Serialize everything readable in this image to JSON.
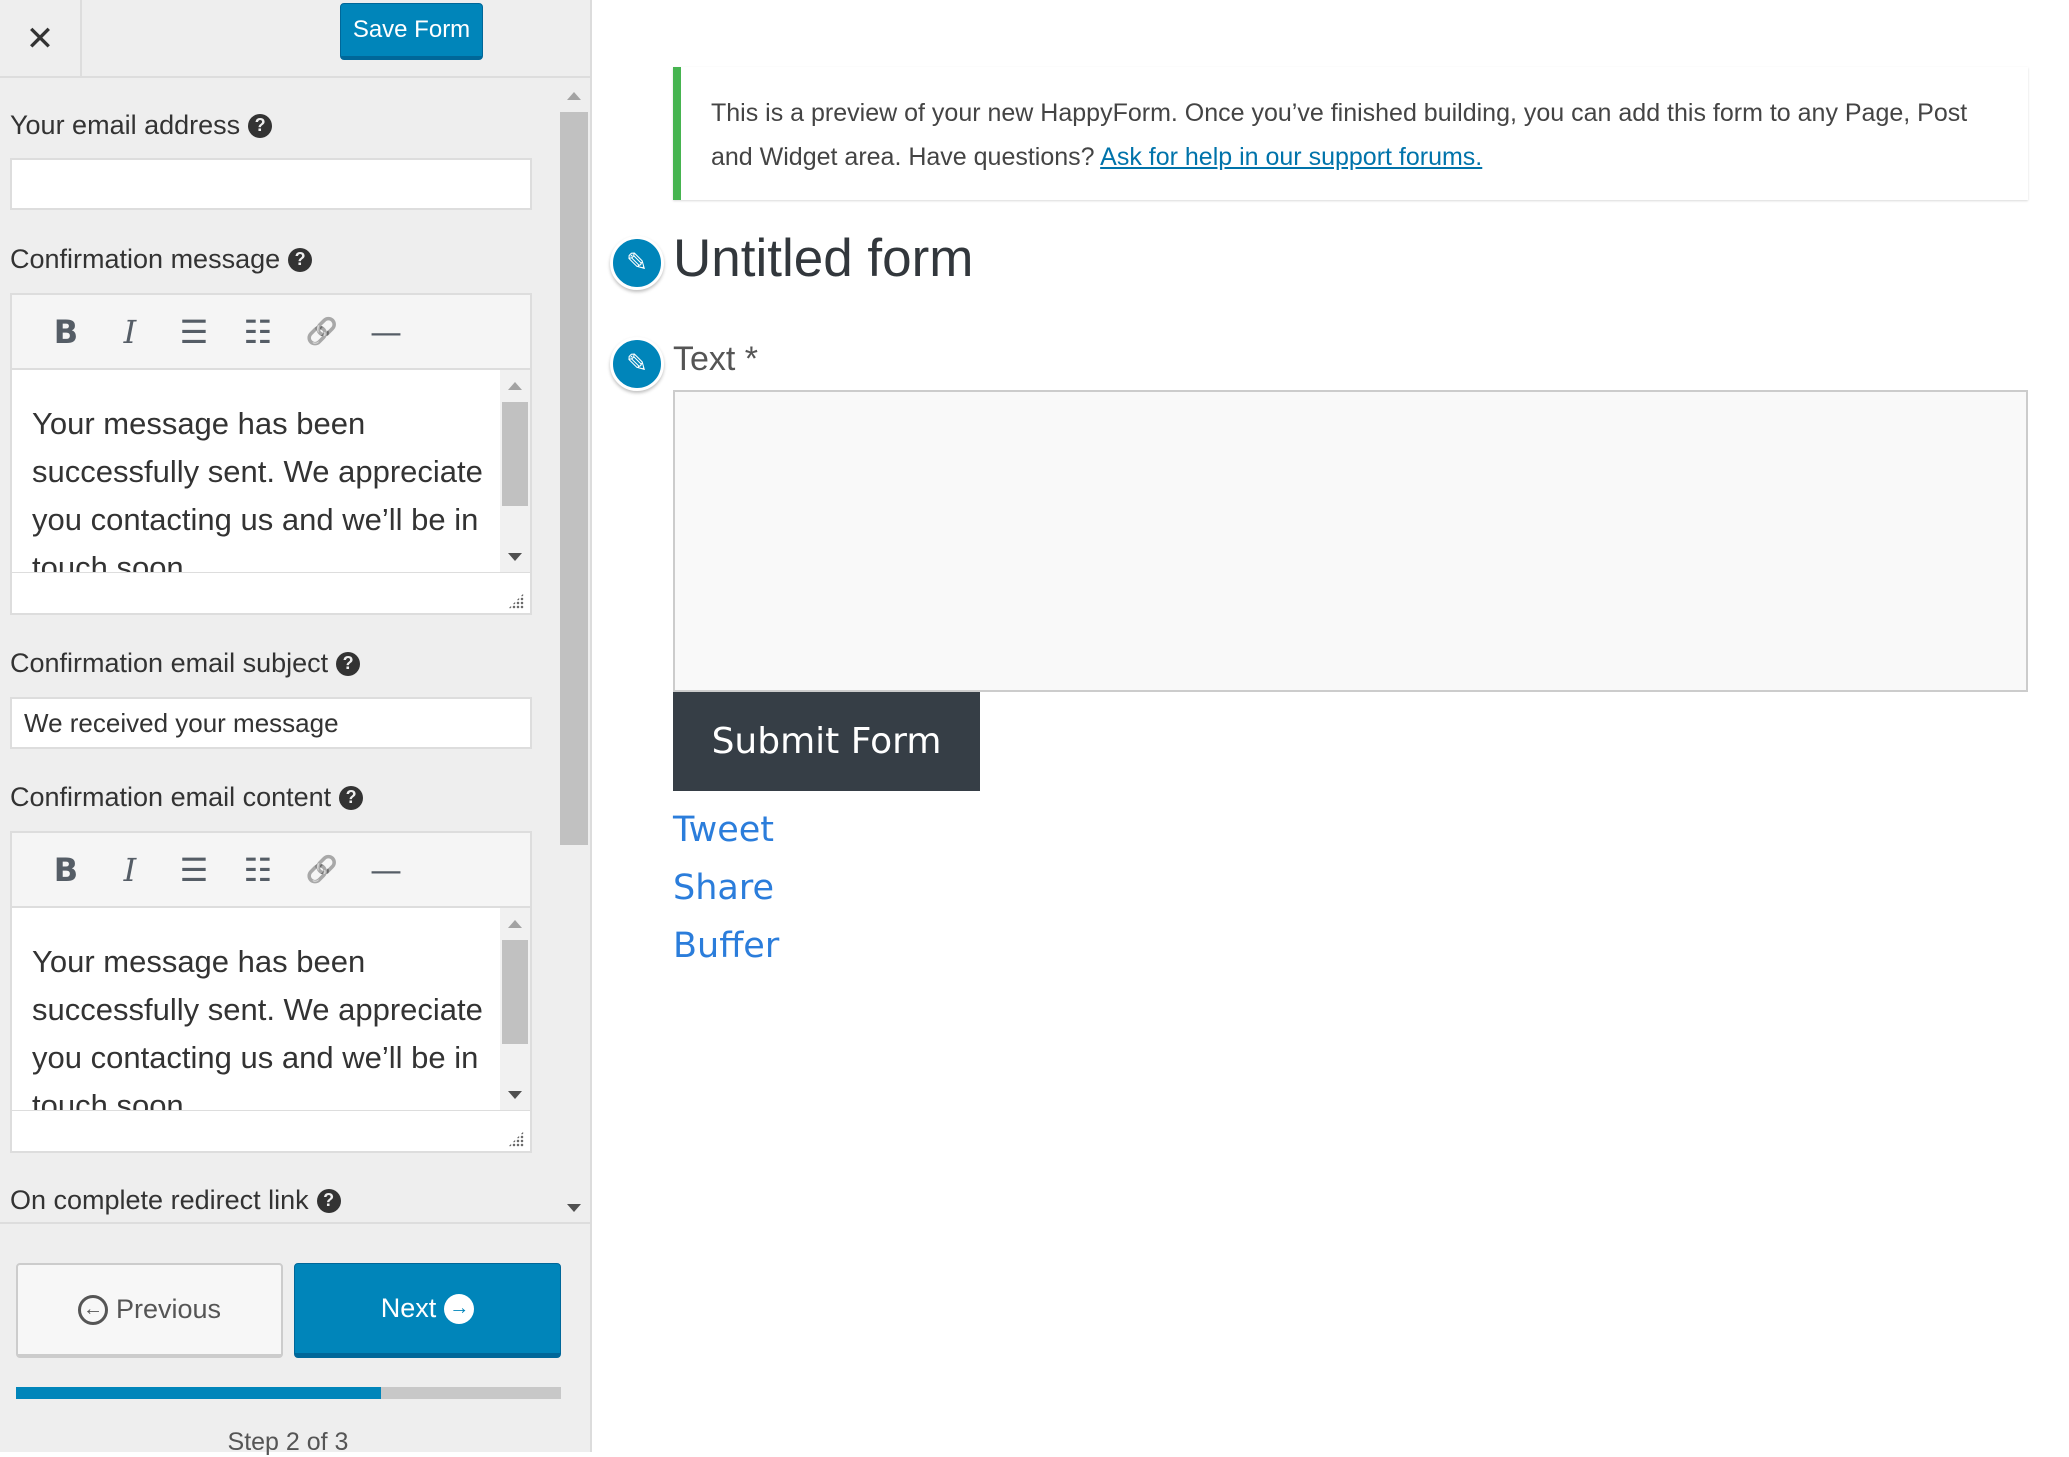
{
  "header": {
    "close_label": "✕",
    "save_label": "Save Form"
  },
  "fields": {
    "email": {
      "label": "Your email address",
      "value": ""
    },
    "confirmation_message": {
      "label": "Confirmation message",
      "content": "Your message has been successfully sent. We appreciate you contacting us and we’ll be in touch soon."
    },
    "email_subject": {
      "label": "Confirmation email subject",
      "value": "We received your message"
    },
    "email_content": {
      "label": "Confirmation email content",
      "content": "Your message has been successfully sent. We appreciate you contacting us and we’ll be in touch soon."
    },
    "redirect": {
      "label": "On complete redirect link"
    }
  },
  "help_glyph": "?",
  "toolbar": {
    "bold": "B",
    "italic": "I",
    "bullet": "☰",
    "numbered": "☷",
    "link": "🔗",
    "hr": "—"
  },
  "nav": {
    "previous_label": "Previous",
    "next_label": "Next",
    "prev_icon": "←",
    "next_icon": "→"
  },
  "progress": {
    "fraction": 0.67,
    "step_text": "Step 2 of 3"
  },
  "preview": {
    "notice_text": "This is a preview of your new HappyForm. Once you’ve finished building, you can add this form to any Page, Post and Widget area. Have questions? ",
    "notice_link": "Ask for help in our support forums.",
    "form_title": "Untitled form",
    "field_label": "Text *",
    "submit_label": "Submit Form",
    "share_links": [
      "Tweet",
      "Share",
      "Buffer"
    ],
    "pencil_glyph": "✎"
  },
  "colors": {
    "accent": "#0085ba",
    "notice_border": "#46b450",
    "submit_bg": "#363e46",
    "share_link": "#2b7ddb"
  }
}
